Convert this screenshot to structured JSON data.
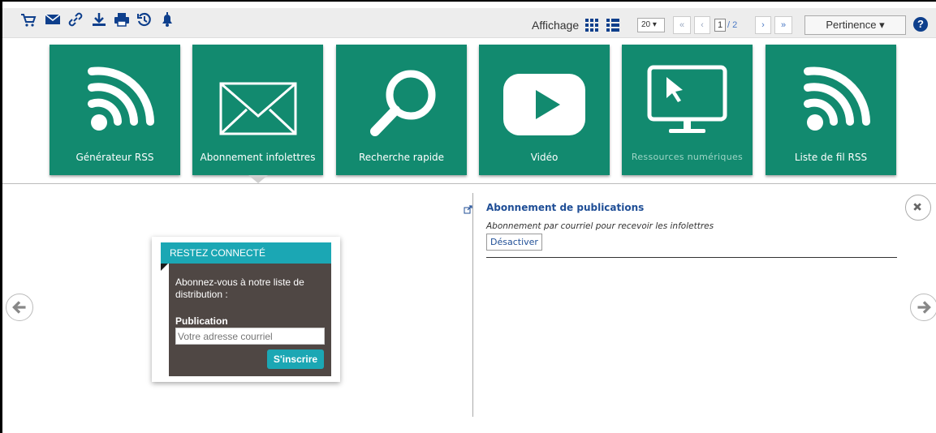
{
  "toolbar": {
    "icons": [
      "cart-icon",
      "envelope-icon",
      "link-icon",
      "download-icon",
      "print-icon",
      "history-icon",
      "bell-icon"
    ],
    "display_label": "Affichage",
    "per_page": "20 ▾",
    "first_page": "«",
    "prev_page": "‹",
    "current_page": "1",
    "page_total": "/ 2",
    "next_page": "›",
    "last_page": "»",
    "sort_label": "Pertinence ▾",
    "help_label": "?"
  },
  "tiles": [
    {
      "label": "Générateur RSS",
      "icon": "rss-icon"
    },
    {
      "label": "Abonnement infolettres",
      "icon": "envelope-icon"
    },
    {
      "label": "Recherche rapide",
      "icon": "magnifier-icon"
    },
    {
      "label": "Vidéo",
      "icon": "play-icon"
    },
    {
      "label": "Ressources numériques",
      "icon": "monitor-icon"
    },
    {
      "label": "Liste de fil RSS",
      "icon": "rss-icon"
    }
  ],
  "widget": {
    "header": "RESTEZ CONNECTÉ",
    "text": "Abonnez-vous à notre liste de distribution :",
    "publication_label": "Publication",
    "email_placeholder": "Votre adresse courriel",
    "submit_label": "S'inscrire"
  },
  "publication": {
    "title": "Abonnement de publications",
    "description": "Abonnement par courriel pour recevoir les infolettres",
    "deactivate_label": "Désactiver"
  },
  "colors": {
    "tile": "#128a6f",
    "accent": "#1ba7b4",
    "widget_body": "#4f4744",
    "link": "#1f4e96",
    "toolbar_icons": "#0e3f8c"
  }
}
